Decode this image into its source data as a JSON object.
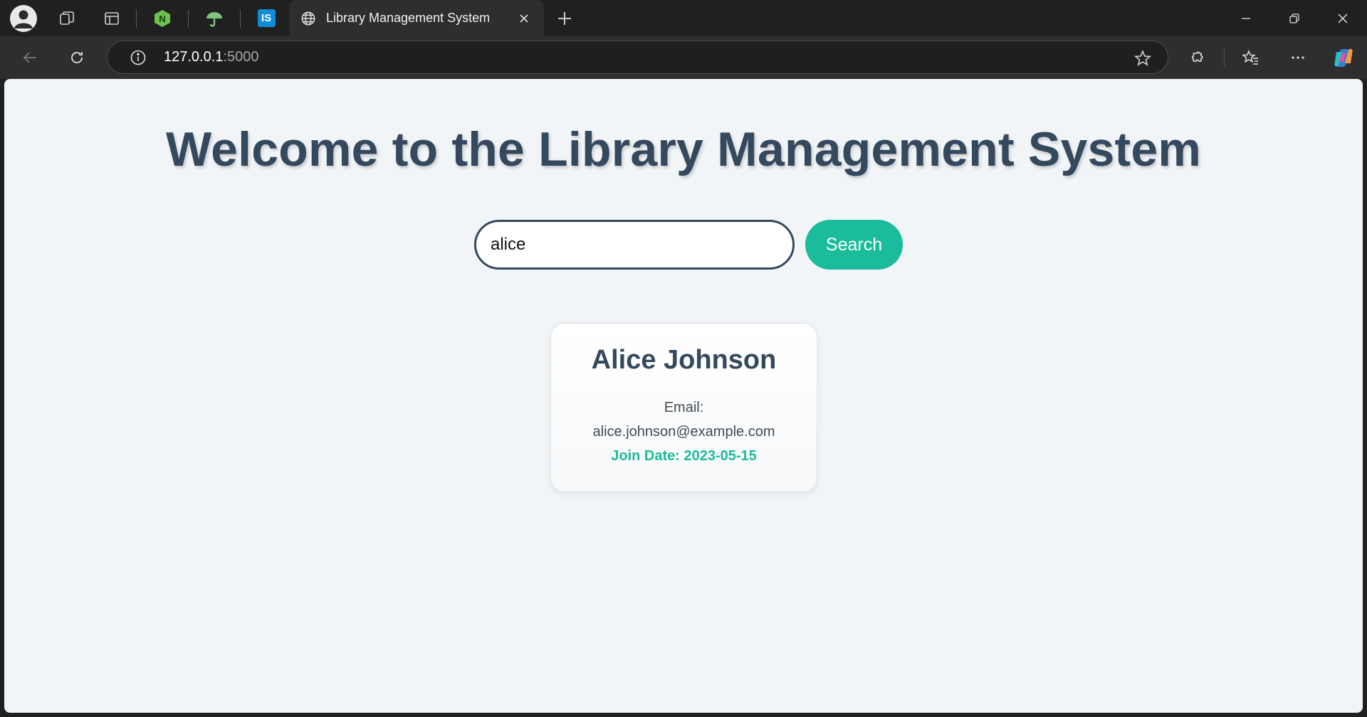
{
  "browser": {
    "active_tab": {
      "title": "Library Management System",
      "icon": "globe-icon"
    },
    "pinned_tabs": [
      {
        "icon": "node-icon",
        "color": "#6cc24a"
      },
      {
        "icon": "umbrella-icon",
        "color": "#7cc47f"
      },
      {
        "icon": "is-badge-icon",
        "label": "IS",
        "color": "#0e8ed9"
      }
    ],
    "address": {
      "host": "127.0.0.1",
      "port": ":5000"
    }
  },
  "page": {
    "heading": "Welcome to the Library Management System",
    "search": {
      "value": "alice",
      "button_label": "Search"
    },
    "results": [
      {
        "name": "Alice Johnson",
        "email_label": "Email:",
        "email": "alice.johnson@example.com",
        "join_date_label": "Join Date: 2023-05-15"
      }
    ]
  },
  "colors": {
    "heading": "#34495e",
    "accent": "#1abc9c",
    "page_bg": "#f2f5f8"
  }
}
